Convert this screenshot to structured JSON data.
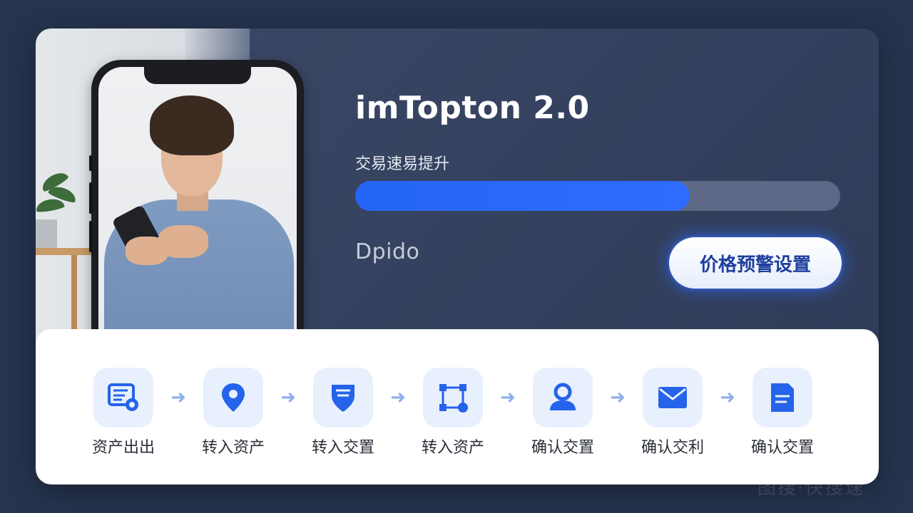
{
  "app": {
    "title": "imTopton 2.0",
    "subtitle": "交易速易提升",
    "progress_percent": 69,
    "brand": "Dpido",
    "alert_button_label": "价格预警设置"
  },
  "steps": [
    {
      "label": "资产出出",
      "icon": "invoice-icon"
    },
    {
      "label": "转入资产",
      "icon": "location-pin-icon"
    },
    {
      "label": "转入交置",
      "icon": "shield-icon"
    },
    {
      "label": "转入资产",
      "icon": "vector-edit-icon"
    },
    {
      "label": "确认交置",
      "icon": "user-icon"
    },
    {
      "label": "确认交利",
      "icon": "mail-icon"
    },
    {
      "label": "确认交置",
      "icon": "document-icon"
    }
  ],
  "watermark": "图搜·快搜速",
  "colors": {
    "accent": "#2e6cff",
    "background": "#26344f",
    "card": "#3a4664",
    "icon_bg": "#e8f0fe"
  }
}
